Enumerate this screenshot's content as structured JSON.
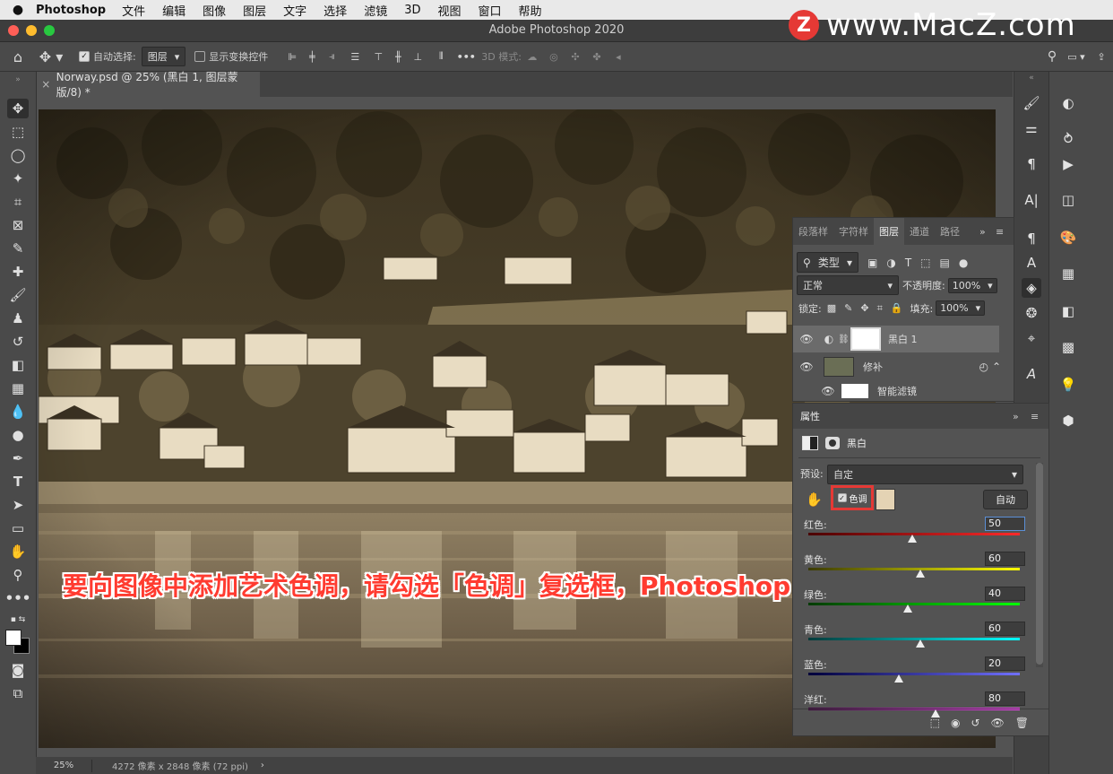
{
  "menubar": {
    "apple": "",
    "app": "Photoshop",
    "items": [
      "文件",
      "编辑",
      "图像",
      "图层",
      "文字",
      "选择",
      "滤镜",
      "3D",
      "视图",
      "窗口",
      "帮助"
    ]
  },
  "window": {
    "title": "Adobe Photoshop 2020"
  },
  "watermark": {
    "logo_letter": "Z",
    "text": "www.MacZ.com"
  },
  "options": {
    "auto_select_label": "自动选择:",
    "auto_select_value": "图层",
    "show_transform_label": "显示变换控件",
    "three_d_label": "3D 模式:",
    "more": "•••"
  },
  "document": {
    "tab_label": "Norway.psd @ 25% (黑白 1, 图层蒙版/8) *",
    "close": "×",
    "zoom": "25%",
    "info": "4272 像素 x 2848 像素 (72 ppi)"
  },
  "layers_panel": {
    "tabs": [
      "段落样",
      "字符样",
      "图层",
      "通道",
      "路径"
    ],
    "active_tab": "图层",
    "filter_label": "类型",
    "blend_mode": "正常",
    "opacity_label": "不透明度:",
    "opacity_value": "100%",
    "lock_label": "锁定:",
    "fill_label": "填充:",
    "fill_value": "100%",
    "layers": [
      {
        "name": "黑白 1",
        "selected": true
      },
      {
        "name": "修补",
        "selected": false
      },
      {
        "name": "智能滤镜",
        "selected": false
      }
    ]
  },
  "properties_panel": {
    "title": "属性",
    "adjustment_name": "黑白",
    "preset_label": "预设:",
    "preset_value": "自定",
    "tint_label": "色调",
    "tint_checked": true,
    "tint_color": "#e4d3b4",
    "auto_button": "自动",
    "sliders": [
      {
        "label": "红色:",
        "value": "50",
        "position": 0.49
      },
      {
        "label": "黄色:",
        "value": "60",
        "position": 0.53
      },
      {
        "label": "绿色:",
        "value": "40",
        "position": 0.47
      },
      {
        "label": "青色:",
        "value": "60",
        "position": 0.53
      },
      {
        "label": "蓝色:",
        "value": "20",
        "position": 0.43
      },
      {
        "label": "洋红:",
        "value": "80",
        "position": 0.6
      }
    ]
  },
  "caption": "要向图像中添加艺术色调，请勾选「色调」复选框，Photoshop 会为照片添加浅棕色",
  "colors": {
    "highlight": "#e53935",
    "caption": "#ff3b30"
  }
}
